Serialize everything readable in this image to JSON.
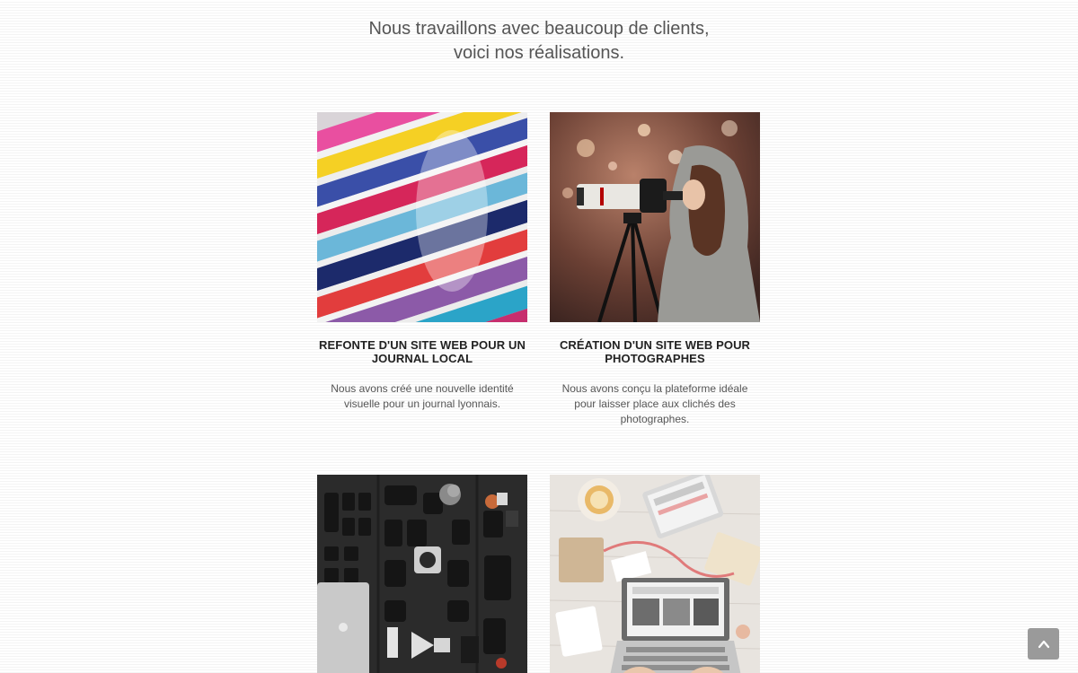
{
  "intro": {
    "line1": "Nous travaillons avec beaucoup de clients,",
    "line2": "voici nos réalisations."
  },
  "projects": [
    {
      "title": "Refonte d'un site web pour un journal local",
      "description": "Nous avons créé une nouvelle identité visuelle pour un journal lyonnais.",
      "image": "magazines-stack-image"
    },
    {
      "title": "Création d'un site web pour photographes",
      "description": "Nous avons conçu la plateforme idéale pour laisser place aux clichés des photographes.",
      "image": "photographer-camera-image"
    },
    {
      "title": "",
      "description": "",
      "image": "camera-gear-flatlay-image"
    },
    {
      "title": "",
      "description": "",
      "image": "workspace-laptop-image"
    }
  ],
  "scroll_top": {
    "icon": "chevron-up-icon"
  },
  "colors": {
    "scroll_button": "#9a9a9a",
    "text": "#555555",
    "heading": "#222222"
  }
}
